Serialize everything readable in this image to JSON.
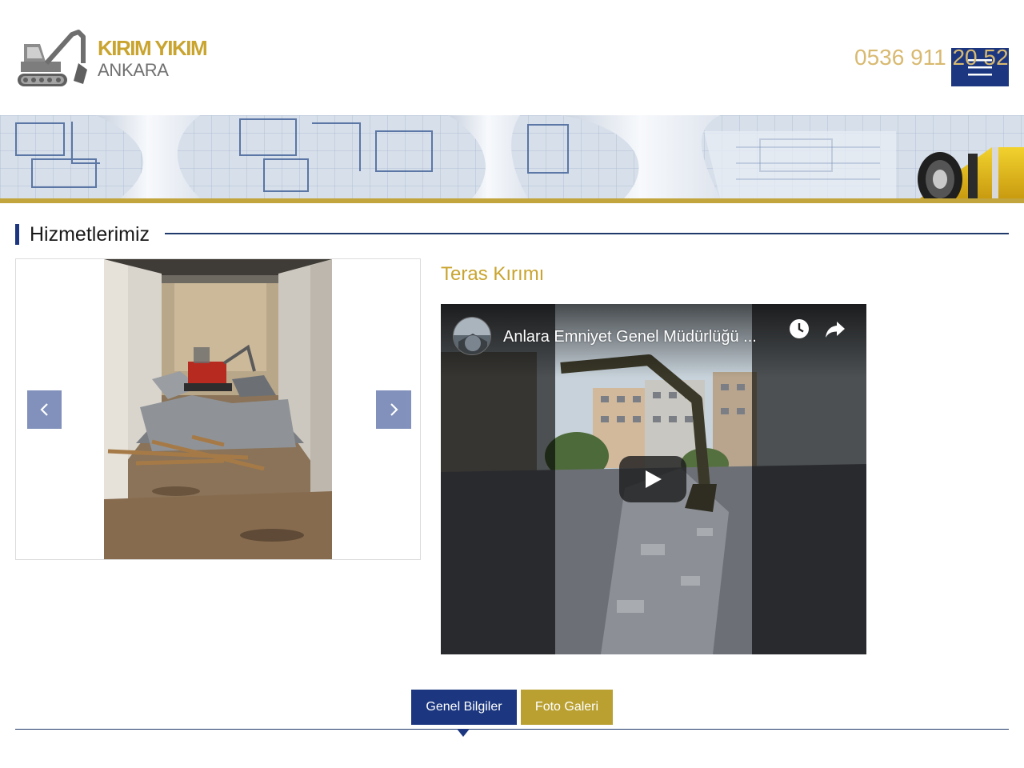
{
  "header": {
    "logo": {
      "line1": "KIRIM YIKIM",
      "line2": "ANKARA"
    },
    "phone": "0536 911 20 52"
  },
  "section": {
    "title": "Hizmetlerimiz"
  },
  "service": {
    "title": "Teras Kırımı",
    "video": {
      "title": "Anlara Emniyet Genel Müdürlüğü ..."
    }
  },
  "tabs": [
    {
      "label": "Genel Bilgiler",
      "active": true
    },
    {
      "label": "Foto Galeri",
      "active": false
    }
  ],
  "icons": {
    "logo": "excavator-icon",
    "menu": "hamburger-icon",
    "prev": "chevron-left-icon",
    "next": "chevron-right-icon",
    "play": "play-icon",
    "watch_later": "clock-icon",
    "share": "share-icon"
  },
  "colors": {
    "gold": "#c9a42f",
    "navy": "#1c3780",
    "tab_gold": "#b9a031",
    "slider_button": "#7b8cb9",
    "phone": "#d8b970",
    "line": "#1f3a6b",
    "strip": "#c2a53c"
  }
}
